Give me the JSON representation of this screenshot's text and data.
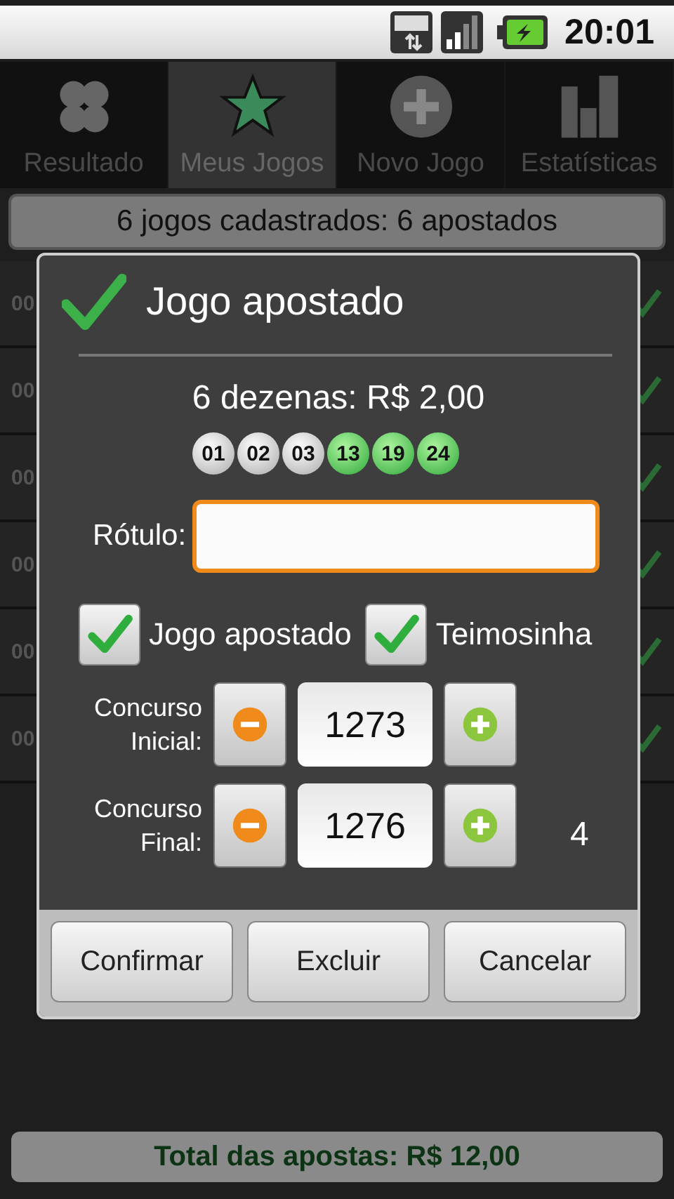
{
  "status_bar": {
    "time": "20:01"
  },
  "tabs": [
    {
      "label": "Resultado",
      "selected": false
    },
    {
      "label": "Meus Jogos",
      "selected": true
    },
    {
      "label": "Novo Jogo",
      "selected": false
    },
    {
      "label": "Estatísticas",
      "selected": false
    }
  ],
  "summary": "6 jogos cadastrados: 6 apostados",
  "rows": [
    {
      "number": "00",
      "checked": true
    },
    {
      "number": "00",
      "checked": true
    },
    {
      "number": "00",
      "checked": true
    },
    {
      "number": "00",
      "checked": true
    },
    {
      "number": "00",
      "checked": true
    },
    {
      "number": "00",
      "checked": true
    }
  ],
  "total": "Total das apostas: R$ 12,00",
  "dialog": {
    "title": "Jogo apostado",
    "price": "6 dezenas: R$ 2,00",
    "numbers": [
      {
        "value": "01",
        "highlighted": false
      },
      {
        "value": "02",
        "highlighted": false
      },
      {
        "value": "03",
        "highlighted": false
      },
      {
        "value": "13",
        "highlighted": true
      },
      {
        "value": "19",
        "highlighted": true
      },
      {
        "value": "24",
        "highlighted": true
      }
    ],
    "label_field": {
      "label": "Rótulo:",
      "focused": true
    },
    "checkboxes": [
      {
        "label": "Jogo apostado",
        "checked": true
      },
      {
        "label": "Teimosinha",
        "checked": true
      }
    ],
    "steppers": [
      {
        "label": "Concurso Inicial:",
        "value": "1273"
      },
      {
        "label": "Concurso Final:",
        "value": "1276"
      }
    ],
    "count": "4",
    "buttons": [
      "Confirmar",
      "Excluir",
      "Cancelar"
    ]
  }
}
